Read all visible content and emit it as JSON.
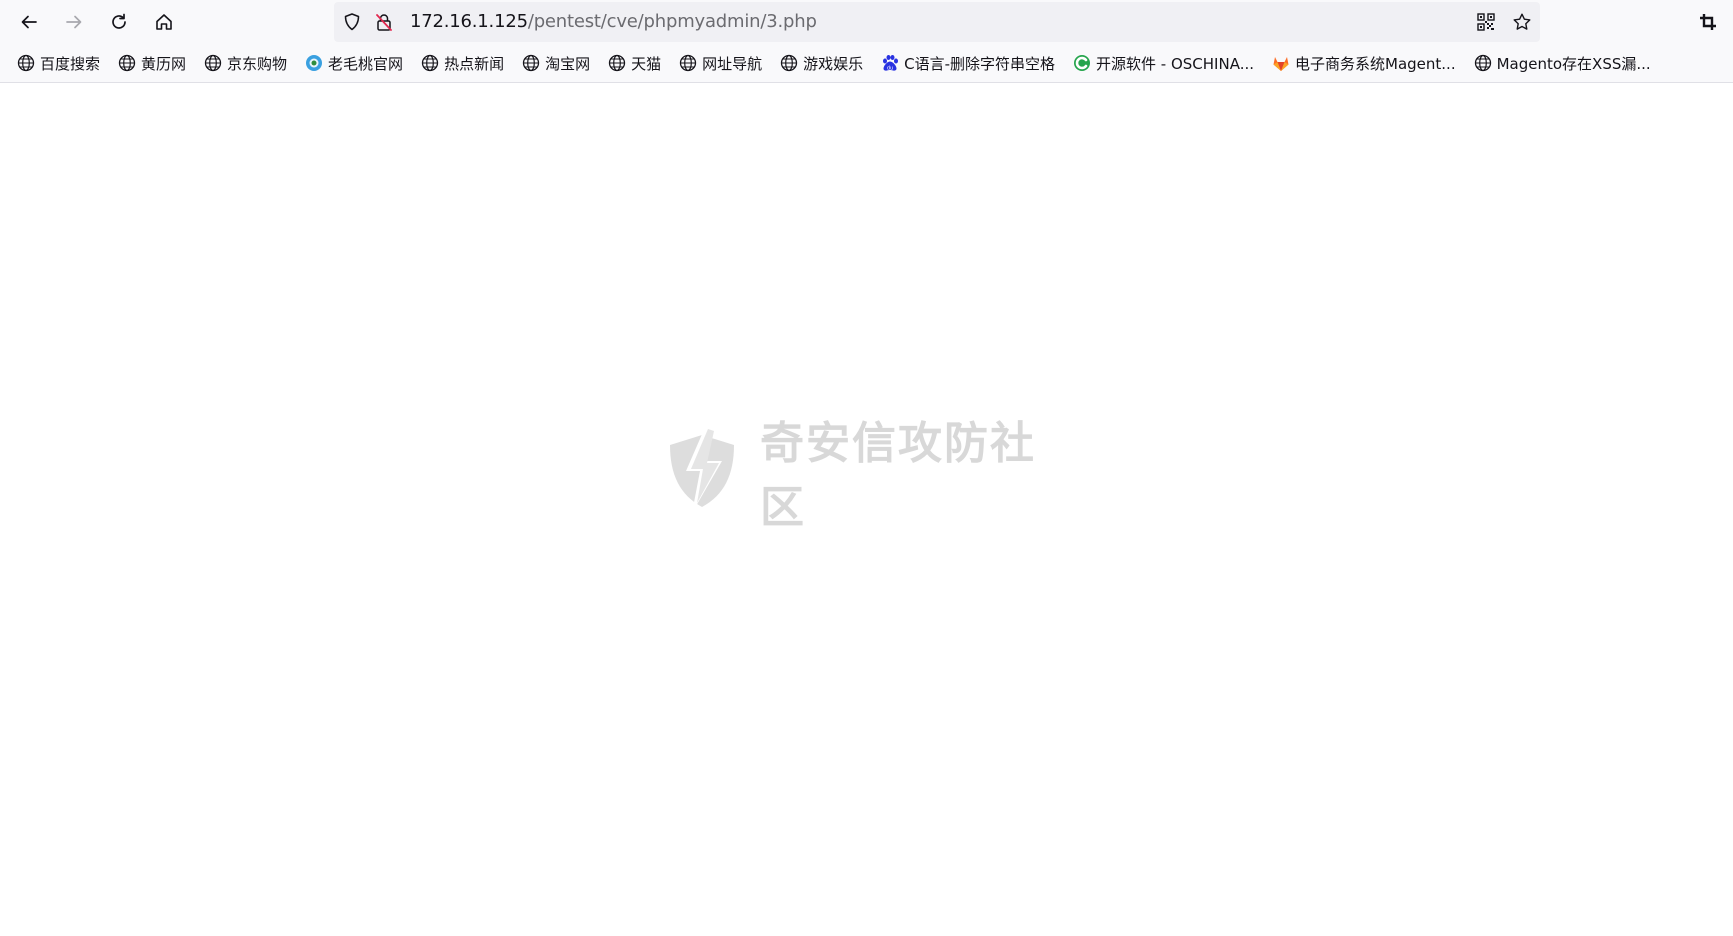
{
  "toolbar": {
    "back_icon": "arrow-left-icon",
    "forward_icon": "arrow-right-icon",
    "reload_icon": "reload-icon",
    "home_icon": "home-icon"
  },
  "urlbar": {
    "host": "172.16.1.125",
    "path": "/pentest/cve/phpmyadmin/3.php",
    "shield_icon": "shield-icon",
    "insecure_icon": "insecure-lock-icon",
    "qr_icon": "qr-code-icon",
    "bookmark_star_icon": "star-icon"
  },
  "toolbar_right": {
    "extension_icon": "crop-icon"
  },
  "bookmarks": [
    {
      "label": "百度搜索",
      "icon": "globe-icon"
    },
    {
      "label": "黄历网",
      "icon": "globe-icon"
    },
    {
      "label": "京东购物",
      "icon": "globe-icon"
    },
    {
      "label": "老毛桃官网",
      "icon": "laomaotao-logo-icon"
    },
    {
      "label": "热点新闻",
      "icon": "globe-icon"
    },
    {
      "label": "淘宝网",
      "icon": "globe-icon"
    },
    {
      "label": "天猫",
      "icon": "globe-icon"
    },
    {
      "label": "网址导航",
      "icon": "globe-icon"
    },
    {
      "label": "游戏娱乐",
      "icon": "globe-icon"
    },
    {
      "label": "C语言-删除字符串空格",
      "icon": "baidu-paw-icon"
    },
    {
      "label": "开源软件 - OSCHINA...",
      "icon": "oschina-logo-icon"
    },
    {
      "label": "电子商务系统Magent...",
      "icon": "gitlab-fox-icon"
    },
    {
      "label": "Magento存在XSS漏...",
      "icon": "globe-icon"
    }
  ],
  "watermark": {
    "text": "奇安信攻防社区",
    "icon": "qianxin-shield-bolt-icon"
  },
  "colors": {
    "toolbar_bg": "#f9f9fb",
    "urlbar_bg": "#f0f0f4",
    "text": "#15141a",
    "url_path": "#6b6b70",
    "insecure_red": "#e22850",
    "watermark": "#b9b9b9"
  }
}
